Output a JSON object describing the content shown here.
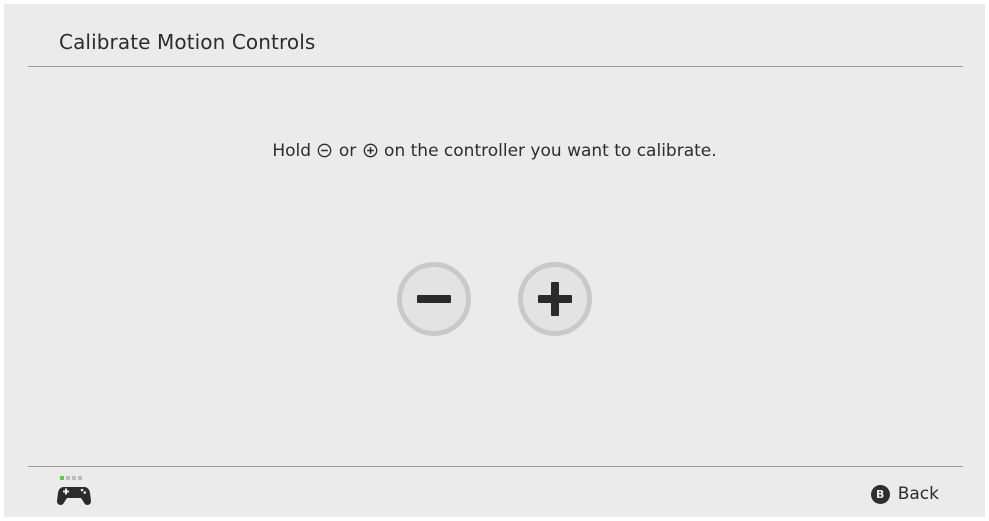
{
  "header": {
    "title": "Calibrate Motion Controls"
  },
  "instruction": {
    "prefix": "Hold",
    "minus_icon": "minus-circle-icon",
    "conjunction": "or",
    "plus_icon": "plus-circle-icon",
    "suffix": "on the controller you want to calibrate."
  },
  "buttons": [
    {
      "icon": "minus-button-icon"
    },
    {
      "icon": "plus-button-icon"
    }
  ],
  "footer": {
    "controller_icon": "controller-icon",
    "controller_indicator": {
      "total": 4,
      "active": 1,
      "active_color": "#5fc94a",
      "inactive_color": "#bdbdbd"
    },
    "back_badge": "B",
    "back_label": "Back"
  },
  "colors": {
    "background": "#ebebeb",
    "text": "#2d2d2d",
    "divider": "#9a9a9a",
    "button_ring": "#c9c9c9"
  }
}
